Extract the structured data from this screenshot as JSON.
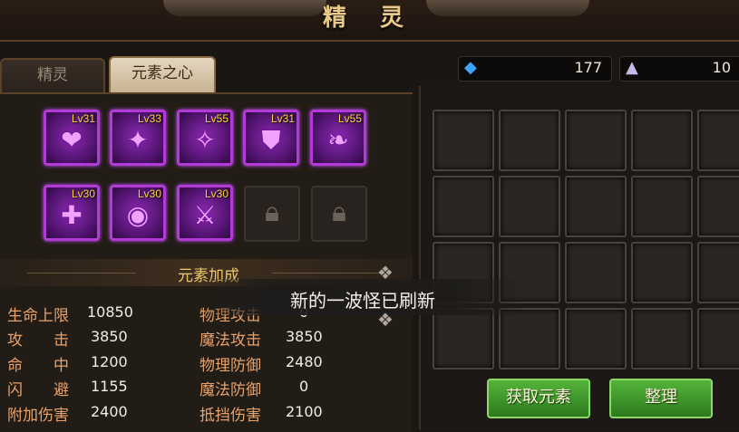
{
  "window": {
    "title": "精 灵"
  },
  "tabs": [
    {
      "label": "精灵",
      "active": false
    },
    {
      "label": "元素之心",
      "active": true
    }
  ],
  "currency": {
    "diamond": {
      "icon": "diamond-icon",
      "value": "177"
    },
    "crystal": {
      "icon": "crystal-icon",
      "value": "10"
    }
  },
  "elements": [
    {
      "level": "Lv31",
      "icon": "heart-crest-icon",
      "glyph": "❤"
    },
    {
      "level": "Lv33",
      "icon": "bird-icon",
      "glyph": "✦"
    },
    {
      "level": "Lv55",
      "icon": "staff-icon",
      "glyph": "✧"
    },
    {
      "level": "Lv31",
      "icon": "shield-icon",
      "glyph": "⛊"
    },
    {
      "level": "Lv55",
      "icon": "feather-icon",
      "glyph": "❧"
    },
    {
      "level": "Lv30",
      "icon": "cross-shield-icon",
      "glyph": "✚"
    },
    {
      "level": "Lv30",
      "icon": "eye-icon",
      "glyph": "◉"
    },
    {
      "level": "Lv30",
      "icon": "sword-wings-icon",
      "glyph": "⚔"
    }
  ],
  "locked_slots": [
    {
      "icon": "lock-icon"
    },
    {
      "icon": "lock-icon"
    }
  ],
  "bonus": {
    "title": "元素加成",
    "left": [
      {
        "label": "生命上限",
        "value": "10850"
      },
      {
        "label": "攻　　击",
        "value": "3850"
      },
      {
        "label": "命　　中",
        "value": "1200"
      },
      {
        "label": "闪　　避",
        "value": "1155"
      },
      {
        "label": "附加伤害",
        "value": "2400"
      }
    ],
    "right": [
      {
        "label": "物理攻击",
        "value": "0"
      },
      {
        "label": "魔法攻击",
        "value": "3850"
      },
      {
        "label": "物理防御",
        "value": "2480"
      },
      {
        "label": "魔法防御",
        "value": "0"
      },
      {
        "label": "抵挡伤害",
        "value": "2100"
      }
    ]
  },
  "inventory": {
    "rows": 4,
    "cols": 5
  },
  "buttons": {
    "get_elements": "获取元素",
    "organize": "整理"
  },
  "toast": {
    "message": "新的一波怪已刷新"
  },
  "colors": {
    "accent": "#b43ad8",
    "level_text": "#ffd93a",
    "stat_label": "#e8a26a",
    "button_green": "#54b43a"
  }
}
